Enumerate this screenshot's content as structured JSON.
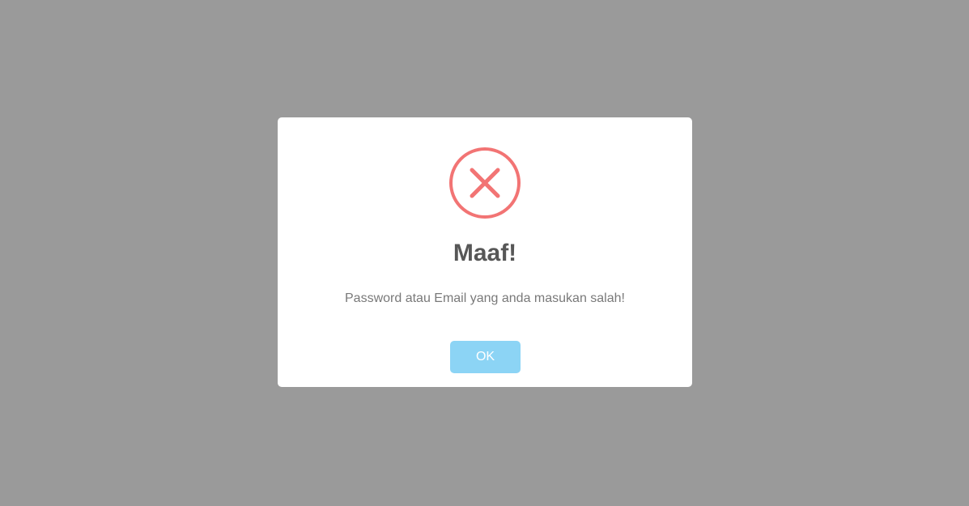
{
  "dialog": {
    "icon": "error-x-icon",
    "icon_color": "#f27474",
    "title": "Maaf!",
    "message": "Password atau Email yang anda masukan salah!",
    "confirm_label": "OK",
    "confirm_color": "#8cd4f5"
  },
  "overlay_color": "#9a9a9a"
}
